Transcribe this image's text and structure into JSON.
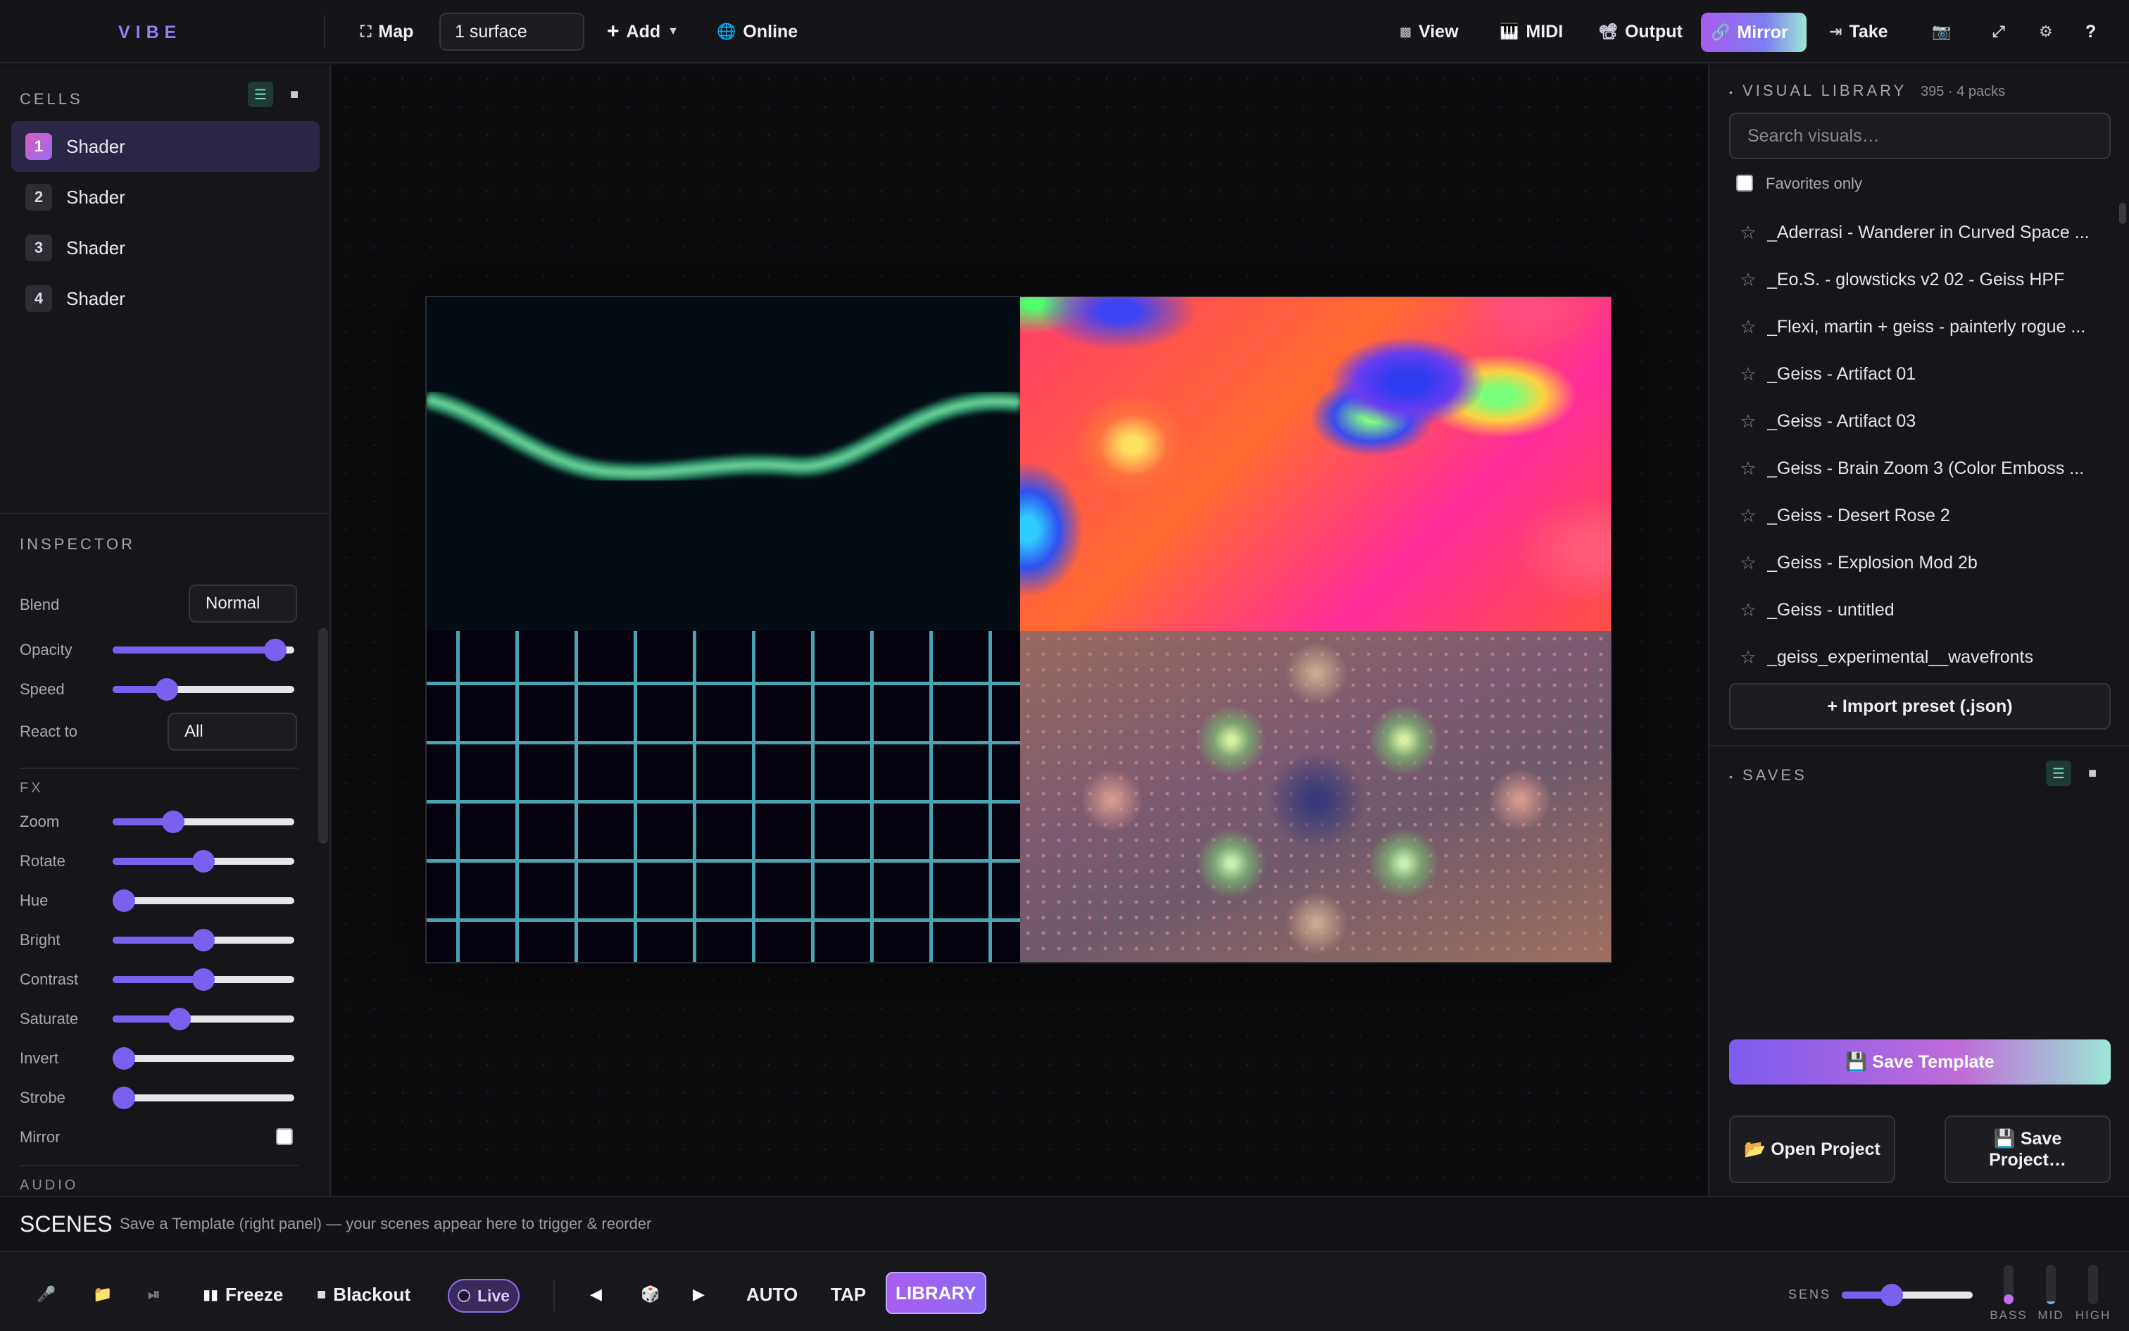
{
  "app": {
    "name": "VIBE"
  },
  "toolbar": {
    "map_label": "Map",
    "surface_value": "1 surface",
    "add_label": "Add",
    "online_label": "Online",
    "view_label": "View",
    "midi_label": "MIDI",
    "output_label": "Output",
    "mirror_label": "Mirror",
    "take_label": "Take",
    "help_label": "?"
  },
  "cells": {
    "title": "CELLS",
    "items": [
      {
        "num": "1",
        "label": "Shader",
        "active": true
      },
      {
        "num": "2",
        "label": "Shader"
      },
      {
        "num": "3",
        "label": "Shader"
      },
      {
        "num": "4",
        "label": "Shader"
      }
    ]
  },
  "inspector": {
    "title": "INSPECTOR",
    "blend_label": "Blend",
    "blend_value": "Normal",
    "opacity_label": "Opacity",
    "opacity_value": 0.95,
    "speed_label": "Speed",
    "speed_value": 0.27,
    "react_label": "React to",
    "react_value": "All",
    "fx_title": "FX",
    "fx": [
      {
        "label": "Zoom",
        "value": 0.31
      },
      {
        "label": "Rotate",
        "value": 0.5
      },
      {
        "label": "Hue",
        "value": 0.0
      },
      {
        "label": "Bright",
        "value": 0.5
      },
      {
        "label": "Contrast",
        "value": 0.5
      },
      {
        "label": "Saturate",
        "value": 0.35
      },
      {
        "label": "Invert",
        "value": 0.0
      },
      {
        "label": "Strobe",
        "value": 0.0
      }
    ],
    "mirror_label": "Mirror",
    "audio_title": "AUDIO"
  },
  "library": {
    "title": "VISUAL LIBRARY",
    "count": "395 · 4 packs",
    "search_placeholder": "Search visuals…",
    "favorites_label": "Favorites only",
    "items": [
      "_Aderrasi - Wanderer in Curved Space ...",
      "_Eo.S. - glowsticks v2 02 - Geiss HPF",
      "_Flexi, martin + geiss - painterly rogue ...",
      "_Geiss - Artifact 01",
      "_Geiss - Artifact 03",
      "_Geiss - Brain Zoom 3 (Color Emboss ...",
      "_Geiss - Desert Rose 2",
      "_Geiss - Explosion Mod 2b",
      "_Geiss - untitled",
      "_geiss_experimental__wavefronts"
    ],
    "import_label": "+ Import preset (.json)"
  },
  "saves": {
    "title": "SAVES",
    "save_template_label": "💾 Save Template",
    "open_project_label": "📂 Open Project",
    "save_project_label": "💾 Save Project…"
  },
  "scenes": {
    "title": "SCENES",
    "hint": "Save a Template (right panel) — your scenes appear here to trigger & reorder"
  },
  "bottom": {
    "freeze_label": "Freeze",
    "blackout_label": "Blackout",
    "live_label": "Live",
    "auto_label": "AUTO",
    "tap_label": "TAP",
    "library_label": "LIBRARY",
    "sens_label": "SENS",
    "sens_value": 0.36,
    "meters": [
      {
        "label": "BASS",
        "level": 0.25,
        "color": "#c46cf0"
      },
      {
        "label": "MID",
        "level": 0.06,
        "color": "#7aa8ff"
      },
      {
        "label": "HIGH",
        "level": 0.0,
        "color": "#7aa8ff"
      }
    ]
  },
  "colors": {
    "accent": "#7b60f0",
    "brand": "#9a7cf8"
  }
}
